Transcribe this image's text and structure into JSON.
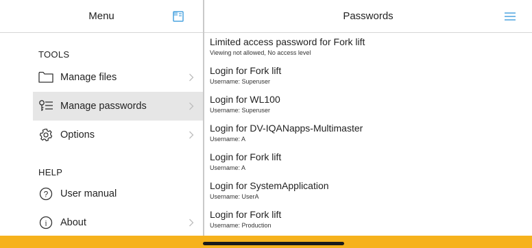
{
  "left": {
    "title": "Menu",
    "sections": [
      {
        "heading": "TOOLS"
      },
      {
        "heading": "HELP"
      }
    ],
    "items": [
      {
        "label": "Manage files",
        "icon": "folder-icon"
      },
      {
        "label": "Manage passwords",
        "icon": "key-list-icon",
        "selected": true
      },
      {
        "label": "Options",
        "icon": "gear-icon"
      },
      {
        "label": "User manual",
        "icon": "question-circle-icon"
      },
      {
        "label": "About",
        "icon": "info-circle-icon"
      }
    ]
  },
  "right": {
    "title": "Passwords",
    "items": [
      {
        "title": "Limited access password for Fork lift",
        "subtitle": "Viewing not allowed, No access level"
      },
      {
        "title": "Login for Fork lift",
        "subtitle": "Username: Superuser"
      },
      {
        "title": "Login for WL100",
        "subtitle": "Username: Superuser"
      },
      {
        "title": "Login for DV-IQANapps-Multimaster",
        "subtitle": "Username: A"
      },
      {
        "title": "Login for Fork lift",
        "subtitle": "Username: A"
      },
      {
        "title": "Login for SystemApplication",
        "subtitle": "Username: UserA"
      },
      {
        "title": "Login for Fork lift",
        "subtitle": "Username: Production"
      }
    ]
  },
  "colors": {
    "accent": "#4aa3df",
    "bottom_bar": "#f6b21c",
    "selected_bg": "#e6e6e6"
  }
}
